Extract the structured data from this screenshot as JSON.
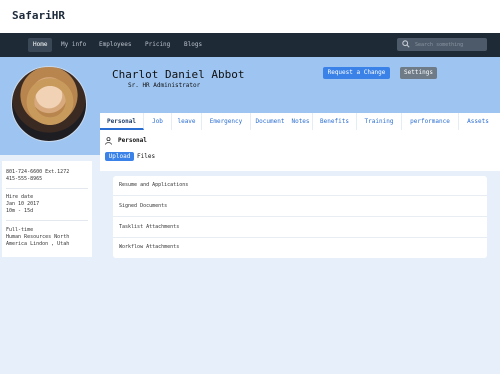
{
  "brand": "SafariHR",
  "nav": {
    "items": [
      {
        "label": "Home",
        "active": true
      },
      {
        "label": "My info",
        "active": false
      },
      {
        "label": "Employees",
        "active": false
      },
      {
        "label": "Pricing",
        "active": false
      },
      {
        "label": "Blogs",
        "active": false
      }
    ],
    "search_placeholder": "Search something"
  },
  "profile": {
    "name": "Charlot Daniel Abbot",
    "role": "Sr. HR Administrator",
    "request_change_label": "Request a Change",
    "settings_label": "Settings"
  },
  "tabs": [
    {
      "label": "Personal",
      "active": true
    },
    {
      "label": "Job",
      "active": false
    },
    {
      "label": "leave",
      "active": false
    },
    {
      "label": "Emergency",
      "active": false
    },
    {
      "label": "Document",
      "active": false
    },
    {
      "label": "Notes",
      "active": false
    },
    {
      "label": "Benefits",
      "active": false
    },
    {
      "label": "Training",
      "active": false
    },
    {
      "label": "performance",
      "active": false
    },
    {
      "label": "Assets",
      "active": false
    }
  ],
  "section": {
    "title": "Personal",
    "upload_label": "Upload",
    "files_label": "Files"
  },
  "contact": {
    "phone_work": "801-724-6600 Ext.1272",
    "phone_mobile": "415-555-8965",
    "hire_label": "Hire date",
    "hire_date": "Jan 10 2017",
    "tenure": "10m - 15d",
    "employment_type": "Full-time",
    "department_line1": "Human Resources North",
    "department_line2": "America Lindon , Utah"
  },
  "files": [
    "Resume and Applications",
    "Signed Documents",
    "Tasklist Attachments",
    "Workflow Attachments"
  ]
}
